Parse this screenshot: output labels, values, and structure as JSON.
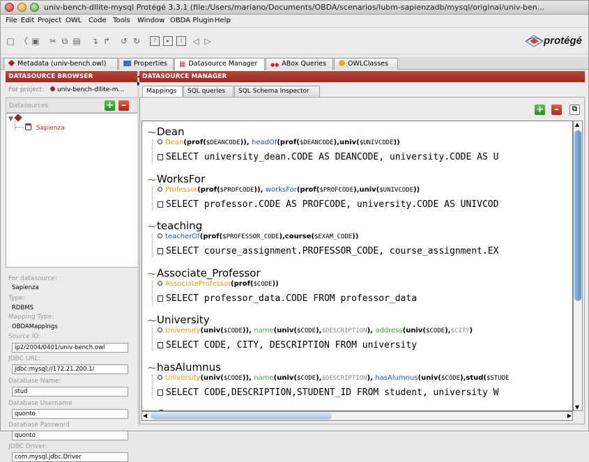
{
  "window": {
    "title": "univ-bench-dllite-mysql  Protégé 3.3.1    (file:/Users/mariano/Documents/OBDA/scenarios/lubm-sapienzadb/mysql/original/univ-ben..."
  },
  "menu": [
    "File",
    "Edit",
    "Project",
    "OWL",
    "Code",
    "Tools",
    "Window",
    "OBDA Plugin",
    "Help"
  ],
  "logo": {
    "text": "protégé"
  },
  "tabs": [
    {
      "label": "Metadata (univ-bench.owl)",
      "icon": "diamond-icon",
      "color": "#a0232b"
    },
    {
      "label": "Properties",
      "icon": "rect-icon",
      "color": "#3a6fc4"
    },
    {
      "label": "Datasource Manager",
      "icon": "ds-icon",
      "color": "#b8473d"
    },
    {
      "label": "ABox Queries",
      "icon": "abox-icon",
      "color": "#c23"
    },
    {
      "label": "OWLClasses",
      "icon": "circle-icon",
      "color": "#e2b21f"
    }
  ],
  "left": {
    "header": "DATASOURCE BROWSER",
    "project_label": "For project:",
    "project_value": "univ-bench-dllite-m...",
    "datasources_label": "Datasources",
    "tree_item": "Sapienza",
    "props": {
      "for_ds_label": "For datasource:",
      "for_ds_value": "Sapienza",
      "type_label": "Type:",
      "type_value": "RDBMS",
      "mapping_type_label": "Mapping Type:",
      "mapping_type_value": "OBDAMappings",
      "source_id_label": "Source ID:",
      "source_id_value": "ip2/2004/0401/univ-bench.owl",
      "jdbc_url_label": "JDBC URL:",
      "jdbc_url_value": "jdbc:mysql://172.21.200.1/",
      "db_name_label": "Database Name:",
      "db_name_value": "stud",
      "db_user_label": "Database Username",
      "db_user_value": "quonto",
      "db_pass_label": "Database Password",
      "db_pass_value": "quonto",
      "jdbc_driver_label": "JDBC Driver:",
      "jdbc_driver_value": "com.mysql.jdbc.Driver"
    }
  },
  "right": {
    "header": "DATASOURCE MANAGER",
    "subtabs": [
      "Mappings",
      "SQL queries",
      "SQL Schema Inspector"
    ],
    "mappings": [
      {
        "id": "Dean",
        "head": [
          {
            "t": "Dean",
            "c": "cls"
          },
          {
            "t": "(",
            "c": "fn"
          },
          {
            "t": "prof",
            "c": "fn"
          },
          {
            "t": "(",
            "c": "fn"
          },
          {
            "t": "$DEANCODE",
            "c": "var"
          },
          {
            "t": ")), ",
            "c": "fn"
          },
          {
            "t": "headOf",
            "c": "prop"
          },
          {
            "t": "(prof(",
            "c": "fn"
          },
          {
            "t": "$DEANCODE",
            "c": "var"
          },
          {
            "t": "),univ(",
            "c": "fn"
          },
          {
            "t": "$UNIVCODE",
            "c": "var"
          },
          {
            "t": "))",
            "c": "fn"
          }
        ],
        "sql": "SELECT university_dean.CODE AS DEANCODE, university.CODE AS U"
      },
      {
        "id": "WorksFor",
        "head": [
          {
            "t": "Professor",
            "c": "cls"
          },
          {
            "t": "(prof(",
            "c": "fn"
          },
          {
            "t": "$PROFCODE",
            "c": "var"
          },
          {
            "t": ")), ",
            "c": "fn"
          },
          {
            "t": "worksFor",
            "c": "prop"
          },
          {
            "t": "(prof(",
            "c": "fn"
          },
          {
            "t": "$PROFCODE",
            "c": "var"
          },
          {
            "t": "),univ(",
            "c": "fn"
          },
          {
            "t": "$UNIVCODE",
            "c": "var"
          },
          {
            "t": "))",
            "c": "fn"
          }
        ],
        "sql": "SELECT professor.CODE AS PROFCODE, university.CODE AS UNIVCOD"
      },
      {
        "id": "teaching",
        "head": [
          {
            "t": "teacherOf",
            "c": "prop"
          },
          {
            "t": "(prof(",
            "c": "fn"
          },
          {
            "t": "$PROFESSOR_CODE",
            "c": "var"
          },
          {
            "t": "),course(",
            "c": "fn"
          },
          {
            "t": "$EXAM_CODE",
            "c": "var"
          },
          {
            "t": "))",
            "c": "fn"
          }
        ],
        "sql": "SELECT course_assignment.PROFESSOR_CODE, course_assignment.EX"
      },
      {
        "id": "Associate_Professor",
        "head": [
          {
            "t": "AssociateProfessor",
            "c": "cls"
          },
          {
            "t": "(prof(",
            "c": "fn"
          },
          {
            "t": "$CODE",
            "c": "var"
          },
          {
            "t": "))",
            "c": "fn"
          }
        ],
        "sql": "SELECT professor_data.CODE FROM professor_data"
      },
      {
        "id": "University",
        "head": [
          {
            "t": "University",
            "c": "cls"
          },
          {
            "t": "(univ(",
            "c": "fn"
          },
          {
            "t": "$CODE",
            "c": "var"
          },
          {
            "t": ")), ",
            "c": "fn"
          },
          {
            "t": "name",
            "c": "grn"
          },
          {
            "t": "(univ(",
            "c": "fn"
          },
          {
            "t": "$CODE",
            "c": "var"
          },
          {
            "t": "),",
            "c": "fn"
          },
          {
            "t": "$DESCRIPTION",
            "c": "lit"
          },
          {
            "t": "), ",
            "c": "fn"
          },
          {
            "t": "address",
            "c": "grn"
          },
          {
            "t": "(univ(",
            "c": "fn"
          },
          {
            "t": "$CODE",
            "c": "var"
          },
          {
            "t": "),",
            "c": "fn"
          },
          {
            "t": "$CITY",
            "c": "lit"
          },
          {
            "t": ")",
            "c": "fn"
          }
        ],
        "sql": "SELECT CODE, CITY, DESCRIPTION FROM university"
      },
      {
        "id": "hasAlumnus",
        "head": [
          {
            "t": "University",
            "c": "cls"
          },
          {
            "t": "(univ(",
            "c": "fn"
          },
          {
            "t": "$CODE",
            "c": "var"
          },
          {
            "t": ")), ",
            "c": "fn"
          },
          {
            "t": "name",
            "c": "grn"
          },
          {
            "t": "(univ(",
            "c": "fn"
          },
          {
            "t": "$CODE",
            "c": "var"
          },
          {
            "t": "),",
            "c": "fn"
          },
          {
            "t": "$DESCRIPTION",
            "c": "lit"
          },
          {
            "t": "), ",
            "c": "fn"
          },
          {
            "t": "hasAlumnus",
            "c": "prop"
          },
          {
            "t": "(univ(",
            "c": "fn"
          },
          {
            "t": "$CODE",
            "c": "var"
          },
          {
            "t": "),stud(",
            "c": "fn"
          },
          {
            "t": "$STUDE",
            "c": "var"
          }
        ],
        "sql": "SELECT CODE,DESCRIPTION,STUDENT_ID FROM student, university W"
      },
      {
        "id": "Course",
        "head": [],
        "sql": ""
      }
    ]
  }
}
